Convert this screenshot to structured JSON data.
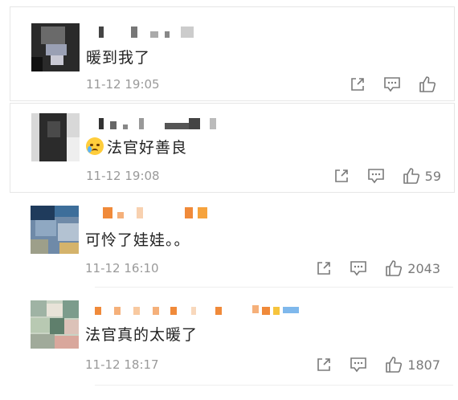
{
  "comments": [
    {
      "text": "暖到我了",
      "time": "11-12 19:05",
      "likes": ""
    },
    {
      "text": "法官好善良",
      "time": "11-12 19:08",
      "likes": "59",
      "emoji": "crying-face-icon"
    },
    {
      "text": "可怜了娃娃。。",
      "time": "11-12 16:10",
      "likes": "2043"
    },
    {
      "text": "法官真的太暖了",
      "time": "11-12 18:17",
      "likes": "1807"
    }
  ],
  "icons": {
    "share": "share-icon",
    "comment": "comment-icon",
    "like": "like-icon"
  },
  "colors": {
    "text": "#222222",
    "meta": "#9a9a9a",
    "icon": "#7a7a7a",
    "emoji": "#ffcd3c"
  }
}
